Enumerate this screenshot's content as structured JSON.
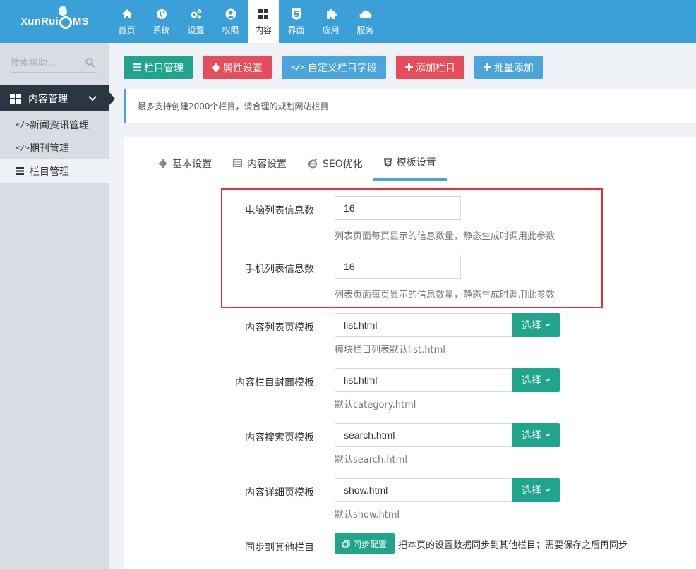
{
  "app": {
    "logo_text_left": "XunRui",
    "logo_text_right": "MS"
  },
  "nav": [
    {
      "label": "首页",
      "icon": "home-icon"
    },
    {
      "label": "系统",
      "icon": "globe-icon"
    },
    {
      "label": "设置",
      "icon": "gears-icon"
    },
    {
      "label": "权限",
      "icon": "user-circle-icon"
    },
    {
      "label": "内容",
      "icon": "grid-icon",
      "active": true
    },
    {
      "label": "界面",
      "icon": "html5-icon"
    },
    {
      "label": "应用",
      "icon": "puzzle-icon"
    },
    {
      "label": "服务",
      "icon": "cloud-icon"
    }
  ],
  "sidebar": {
    "search_placeholder": "搜索帮助...",
    "group_label": "内容管理",
    "items": [
      {
        "label": "新闻资讯管理",
        "icon": "code-icon"
      },
      {
        "label": "期刊管理",
        "icon": "code-icon"
      },
      {
        "label": "栏目管理",
        "icon": "list-icon",
        "active": true
      }
    ]
  },
  "toolbar": {
    "buttons": [
      {
        "label": "栏目管理",
        "icon": "list-icon",
        "color": "#1fa58c"
      },
      {
        "label": "属性设置",
        "icon": "gear-icon",
        "color": "#e74c5a"
      },
      {
        "label": "自定义栏目字段",
        "icon": "code-icon",
        "color": "#4ba5dd"
      },
      {
        "label": "添加栏目",
        "icon": "plus-icon",
        "color": "#e74c5a"
      },
      {
        "label": "批量添加",
        "icon": "plus-icon",
        "color": "#4ba5dd"
      }
    ]
  },
  "notice": "最多支持创建2000个栏目，请合理的规划网站栏目",
  "tabs": [
    {
      "label": "基本设置",
      "icon": "gear-icon"
    },
    {
      "label": "内容设置",
      "icon": "table-icon"
    },
    {
      "label": "SEO优化",
      "icon": "ie-icon"
    },
    {
      "label": "模板设置",
      "icon": "html5-icon",
      "active": true
    }
  ],
  "form": {
    "pc_list_label": "电脑列表信息数",
    "pc_list_value": "16",
    "pc_list_help": "列表页面每页显示的信息数量，静态生成时调用此参数",
    "mobile_list_label": "手机列表信息数",
    "mobile_list_value": "16",
    "mobile_list_help": "列表页面每页显示的信息数量，静态生成时调用此参数",
    "list_tpl_label": "内容列表页模板",
    "list_tpl_value": "list.html",
    "list_tpl_help": "模块栏目列表默认list.html",
    "cover_tpl_label": "内容栏目封面模板",
    "cover_tpl_value": "list.html",
    "cover_tpl_help": "默认category.html",
    "search_tpl_label": "内容搜索页模板",
    "search_tpl_value": "search.html",
    "search_tpl_help": "默认search.html",
    "show_tpl_label": "内容详细页模板",
    "show_tpl_value": "show.html",
    "show_tpl_help": "默认show.html",
    "select_label": "选择",
    "sync_label": "同步到其他栏目",
    "sync_button": "同步配置",
    "sync_help": "把本页的设置数据同步到其他栏目；需要保存之后再同步"
  }
}
